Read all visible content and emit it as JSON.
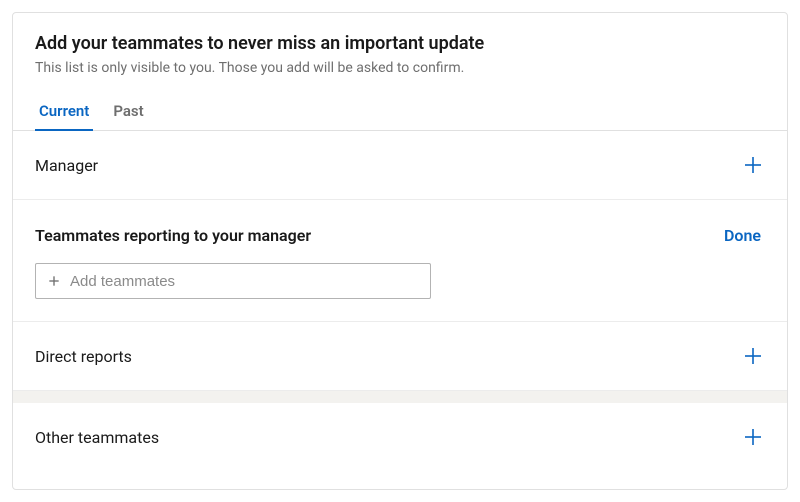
{
  "header": {
    "title": "Add your teammates to never miss an important update",
    "subtitle": "This list is only visible to you. Those you add will be asked to confirm."
  },
  "tabs": {
    "current": "Current",
    "past": "Past"
  },
  "sections": {
    "manager": {
      "label": "Manager"
    },
    "peers": {
      "label": "Teammates reporting to your manager",
      "done": "Done",
      "placeholder": "Add teammates"
    },
    "direct_reports": {
      "label": "Direct reports"
    },
    "other": {
      "label": "Other teammates"
    }
  }
}
